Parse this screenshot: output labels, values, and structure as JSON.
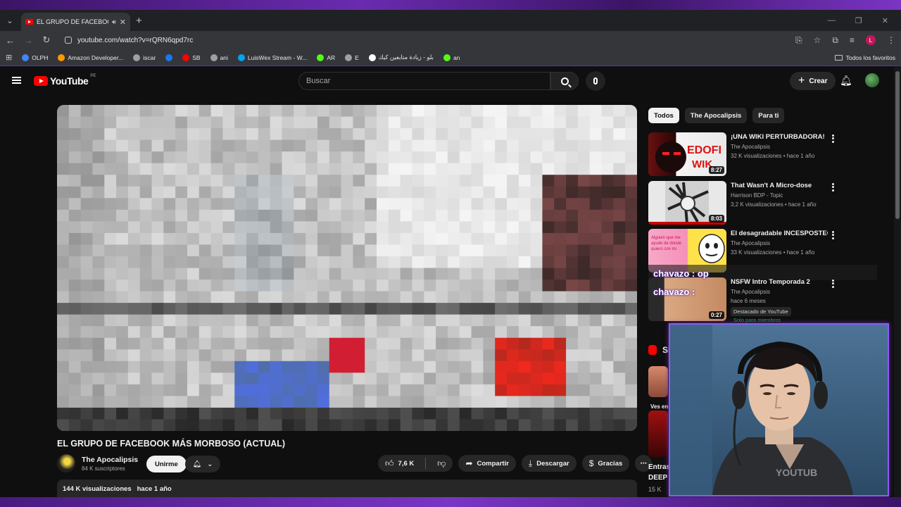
{
  "browser": {
    "tab_title": "EL GRUPO DE FACEBOOK M",
    "url": "youtube.com/watch?v=rQRN6qpd7rc",
    "profile_initial": "L",
    "bookmarks": [
      {
        "label": "OLPH",
        "color": "#4285f4"
      },
      {
        "label": "Amazon Developer...",
        "color": "#ff9900"
      },
      {
        "label": "iscar",
        "color": "#9aa0a6"
      },
      {
        "label": "",
        "color": "#1877f2"
      },
      {
        "label": "SB",
        "color": "#ff0000"
      },
      {
        "label": "ani",
        "color": "#9aa0a6"
      },
      {
        "label": "LuisWex Stream - W...",
        "color": "#00a4ef"
      },
      {
        "label": "AR",
        "color": "#53fc18"
      },
      {
        "label": "E",
        "color": "#9aa0a6"
      },
      {
        "label": "بلو - زيادة متابعين كيك",
        "color": "#ffffff"
      },
      {
        "label": "an",
        "color": "#53fc18"
      }
    ],
    "all_bookmarks_label": "Todos los favoritos"
  },
  "youtube": {
    "logo_text": "YouTube",
    "country_code": "PE",
    "search_placeholder": "Buscar",
    "create_label": "Crear"
  },
  "video": {
    "title": "EL GRUPO DE FACEBOOK MÁS MORBOSO (ACTUAL)",
    "channel_name": "The Apocalipsis",
    "subscribers": "84 K suscriptores",
    "join_label": "Unirme",
    "likes": "7,6 K",
    "share_label": "Compartir",
    "download_label": "Descargar",
    "thanks_label": "Gracias",
    "views": "144 K visualizaciones",
    "age": "hace 1 año"
  },
  "sidebar": {
    "chips": [
      "Todos",
      "The Apocalipsis",
      "Para ti"
    ],
    "recommendations": [
      {
        "title": "¡UNA WIKI PERTURBADORA!",
        "channel": "The Apocalipsis",
        "meta": "32 K visualizaciones • hace 1 año",
        "duration": "8:27"
      },
      {
        "title": "That Wasn't A Micro-dose",
        "channel": "Harrison BDP - Topic",
        "meta": "3,2 K visualizaciones • hace 1 año",
        "duration": "8:03"
      },
      {
        "title": "El desagradable INCESPOSTEO",
        "channel": "The Apocalipsis",
        "meta": "33 K visualizaciones • hace 1 año",
        "duration": ""
      },
      {
        "title": "NSFW Intro Temporada 2",
        "channel": "The Apocalipsis",
        "meta": "hace 6 meses",
        "duration": "0:27",
        "badge": "Destacado de YouTube",
        "members": "Solo para miembros"
      }
    ],
    "shorts_label": "Sh",
    "short_caption_1": "Ves en",
    "short_caption_2": "Entras",
    "short_caption_2b": "DEEP",
    "short_views": "15 K"
  },
  "overlays": {
    "chat_1": "chavazo : op",
    "chat_2": "chavazo :"
  }
}
